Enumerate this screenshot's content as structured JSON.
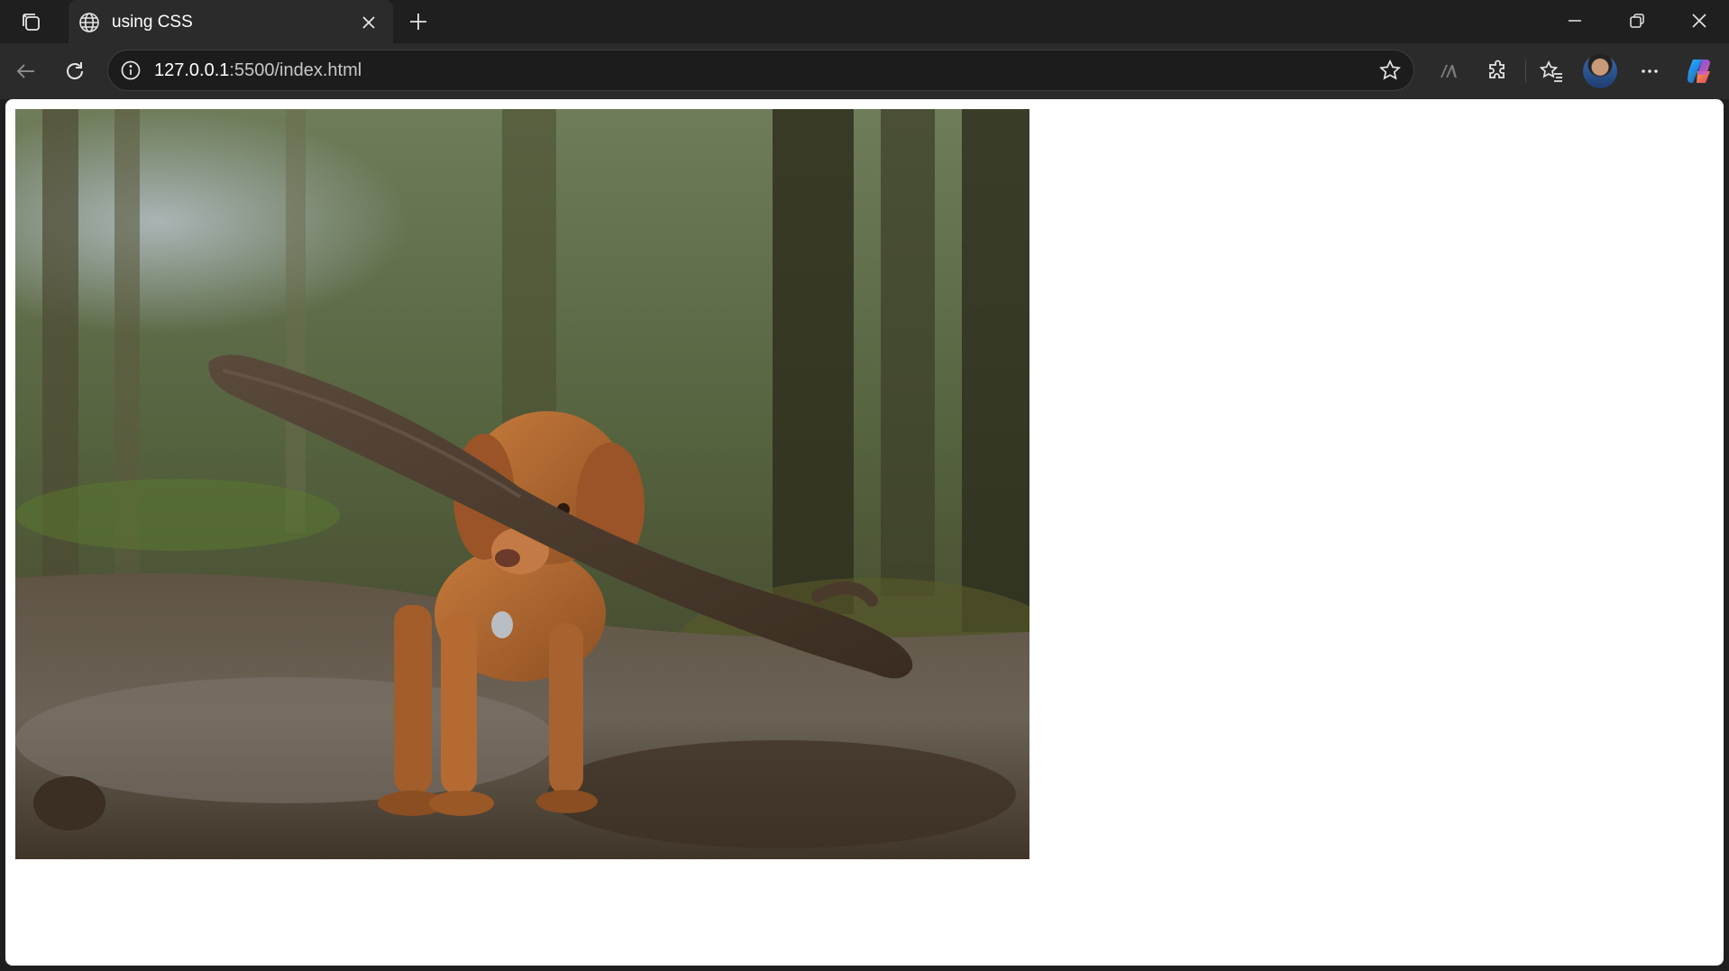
{
  "browser": {
    "tab": {
      "title": "using CSS",
      "icon": "globe-icon"
    },
    "address": {
      "host": "127.0.0.1",
      "rest": ":5500/index.html"
    },
    "colors": {
      "chrome": "#1f1f1f",
      "toolbar": "#2b2b2b",
      "text": "#ffffff"
    }
  },
  "page": {
    "image_alt": "Brown dog carrying a large stick on a forest path"
  }
}
